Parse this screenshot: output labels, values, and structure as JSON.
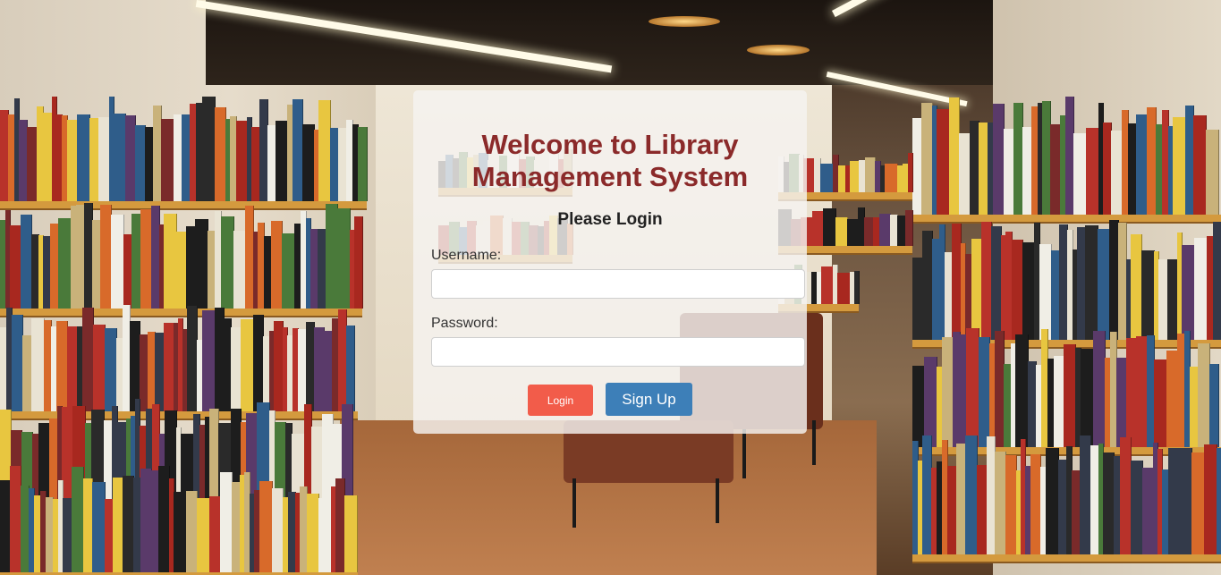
{
  "background": {
    "description_icon": "library-bookshelves-background"
  },
  "login": {
    "title_line1": "Welcome to Library",
    "title_line2": "Management System",
    "subtitle": "Please Login",
    "username_label": "Username:",
    "username_value": "",
    "password_label": "Password:",
    "password_value": "",
    "login_button": "Login",
    "signup_button": "Sign Up"
  },
  "colors": {
    "title": "#8b2a2a",
    "login_button": "#f25c4a",
    "signup_button": "#3d7fb8",
    "card_background": "rgba(245,243,240,0.82)"
  }
}
